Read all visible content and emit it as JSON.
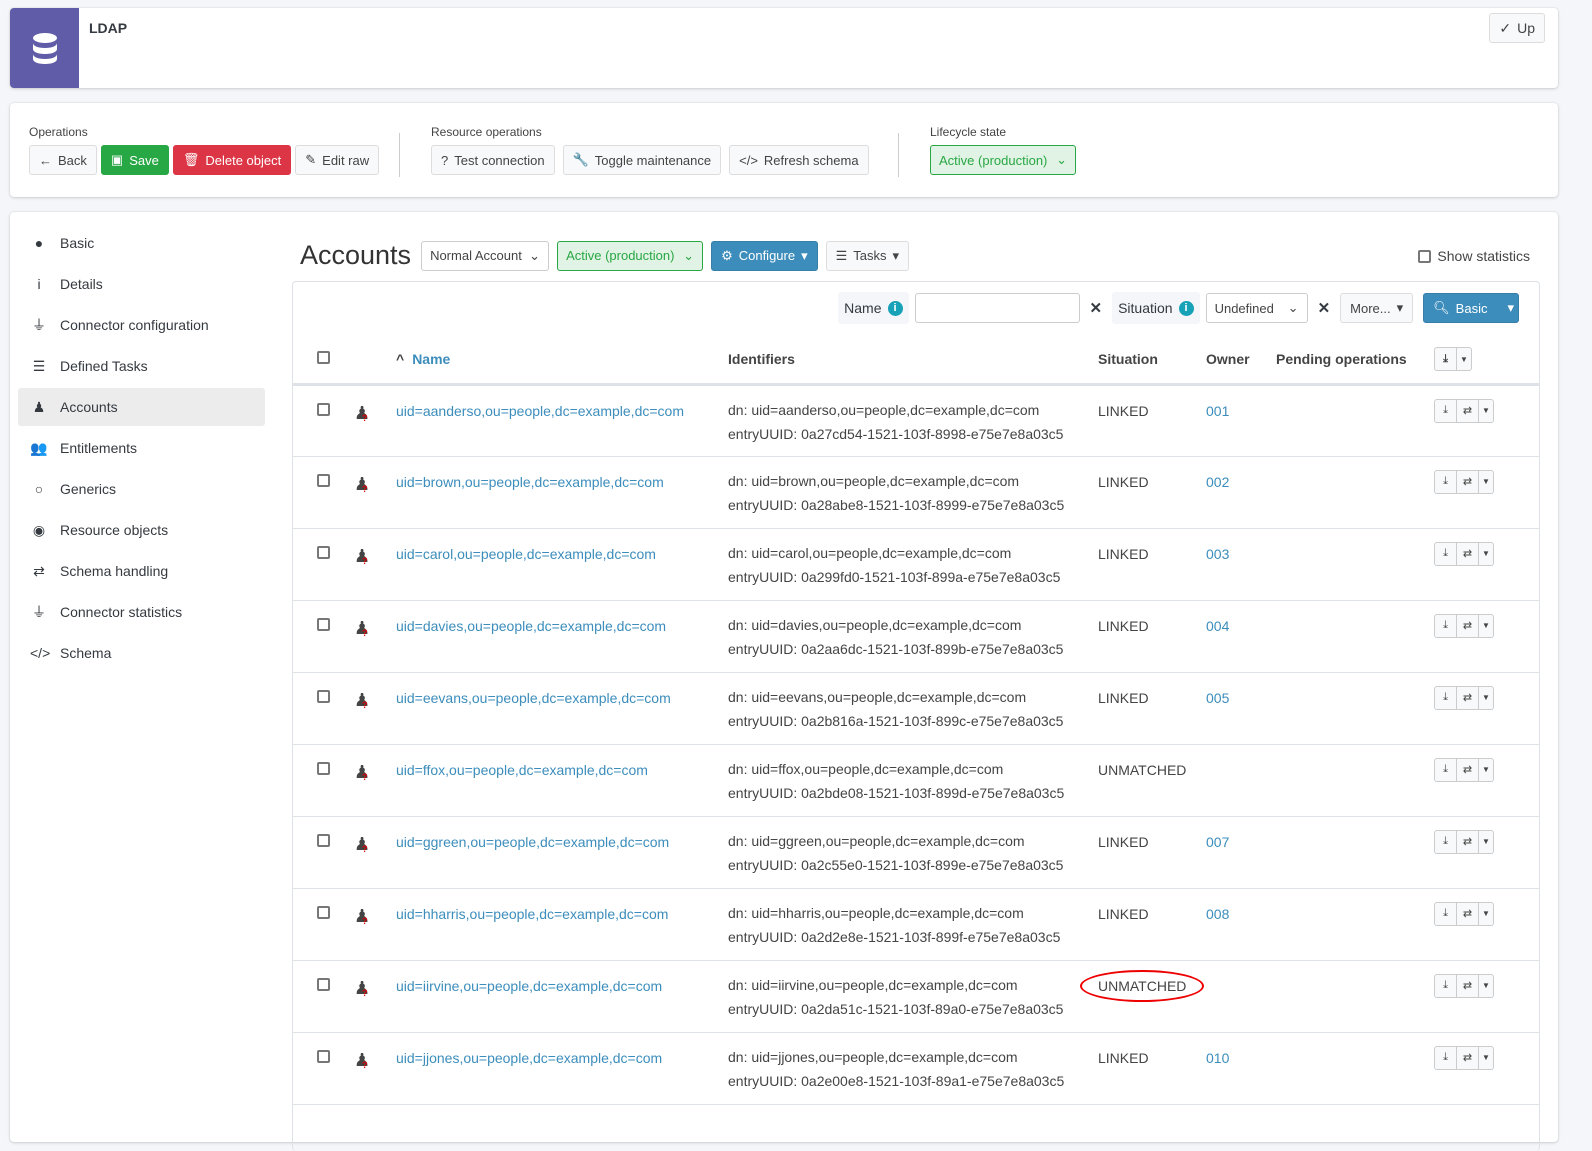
{
  "header": {
    "title": "LDAP",
    "up_label": "Up"
  },
  "operations": {
    "label": "Operations",
    "back": "Back",
    "save": "Save",
    "delete": "Delete object",
    "edit_raw": "Edit raw"
  },
  "resource_operations": {
    "label": "Resource operations",
    "test": "Test connection",
    "toggle": "Toggle maintenance",
    "refresh": "Refresh schema"
  },
  "lifecycle": {
    "label": "Lifecycle state",
    "value": "Active (production)"
  },
  "sidebar": {
    "items": [
      {
        "label": "Basic",
        "icon": "●"
      },
      {
        "label": "Details",
        "icon": "i"
      },
      {
        "label": "Connector configuration",
        "icon": "⏚"
      },
      {
        "label": "Defined Tasks",
        "icon": "☰"
      },
      {
        "label": "Accounts",
        "icon": "♟"
      },
      {
        "label": "Entitlements",
        "icon": "👥"
      },
      {
        "label": "Generics",
        "icon": "○"
      },
      {
        "label": "Resource objects",
        "icon": "◉"
      },
      {
        "label": "Schema handling",
        "icon": "⇄"
      },
      {
        "label": "Connector statistics",
        "icon": "⏚"
      },
      {
        "label": "Schema",
        "icon": "</>"
      }
    ]
  },
  "accounts": {
    "title": "Accounts",
    "kind": "Normal Account",
    "lifecycle": "Active (production)",
    "configure": "Configure",
    "tasks": "Tasks",
    "show_statistics": "Show statistics"
  },
  "filters": {
    "name_label": "Name",
    "name_value": "",
    "situation_label": "Situation",
    "situation_value": "Undefined",
    "more": "More...",
    "search": "Basic"
  },
  "columns": {
    "name": "Name",
    "identifiers": "Identifiers",
    "situation": "Situation",
    "owner": "Owner",
    "pending": "Pending operations"
  },
  "rows": [
    {
      "name": "uid=aanderso,ou=people,dc=example,dc=com",
      "dn": "dn: uid=aanderso,ou=people,dc=example,dc=com",
      "uuid": "entryUUID: 0a27cd54-1521-103f-8998-e75e7e8a03c5",
      "situation": "LINKED",
      "owner": "001"
    },
    {
      "name": "uid=brown,ou=people,dc=example,dc=com",
      "dn": "dn: uid=brown,ou=people,dc=example,dc=com",
      "uuid": "entryUUID: 0a28abe8-1521-103f-8999-e75e7e8a03c5",
      "situation": "LINKED",
      "owner": "002"
    },
    {
      "name": "uid=carol,ou=people,dc=example,dc=com",
      "dn": "dn: uid=carol,ou=people,dc=example,dc=com",
      "uuid": "entryUUID: 0a299fd0-1521-103f-899a-e75e7e8a03c5",
      "situation": "LINKED",
      "owner": "003"
    },
    {
      "name": "uid=davies,ou=people,dc=example,dc=com",
      "dn": "dn: uid=davies,ou=people,dc=example,dc=com",
      "uuid": "entryUUID: 0a2aa6dc-1521-103f-899b-e75e7e8a03c5",
      "situation": "LINKED",
      "owner": "004"
    },
    {
      "name": "uid=eevans,ou=people,dc=example,dc=com",
      "dn": "dn: uid=eevans,ou=people,dc=example,dc=com",
      "uuid": "entryUUID: 0a2b816a-1521-103f-899c-e75e7e8a03c5",
      "situation": "LINKED",
      "owner": "005"
    },
    {
      "name": "uid=ffox,ou=people,dc=example,dc=com",
      "dn": "dn: uid=ffox,ou=people,dc=example,dc=com",
      "uuid": "entryUUID: 0a2bde08-1521-103f-899d-e75e7e8a03c5",
      "situation": "UNMATCHED",
      "owner": ""
    },
    {
      "name": "uid=ggreen,ou=people,dc=example,dc=com",
      "dn": "dn: uid=ggreen,ou=people,dc=example,dc=com",
      "uuid": "entryUUID: 0a2c55e0-1521-103f-899e-e75e7e8a03c5",
      "situation": "LINKED",
      "owner": "007"
    },
    {
      "name": "uid=hharris,ou=people,dc=example,dc=com",
      "dn": "dn: uid=hharris,ou=people,dc=example,dc=com",
      "uuid": "entryUUID: 0a2d2e8e-1521-103f-899f-e75e7e8a03c5",
      "situation": "LINKED",
      "owner": "008"
    },
    {
      "name": "uid=iirvine,ou=people,dc=example,dc=com",
      "dn": "dn: uid=iirvine,ou=people,dc=example,dc=com",
      "uuid": "entryUUID: 0a2da51c-1521-103f-89a0-e75e7e8a03c5",
      "situation": "UNMATCHED",
      "owner": "",
      "highlighted": true
    },
    {
      "name": "uid=jjones,ou=people,dc=example,dc=com",
      "dn": "dn: uid=jjones,ou=people,dc=example,dc=com",
      "uuid": "entryUUID: 0a2e00e8-1521-103f-89a1-e75e7e8a03c5",
      "situation": "LINKED",
      "owner": "010"
    }
  ]
}
